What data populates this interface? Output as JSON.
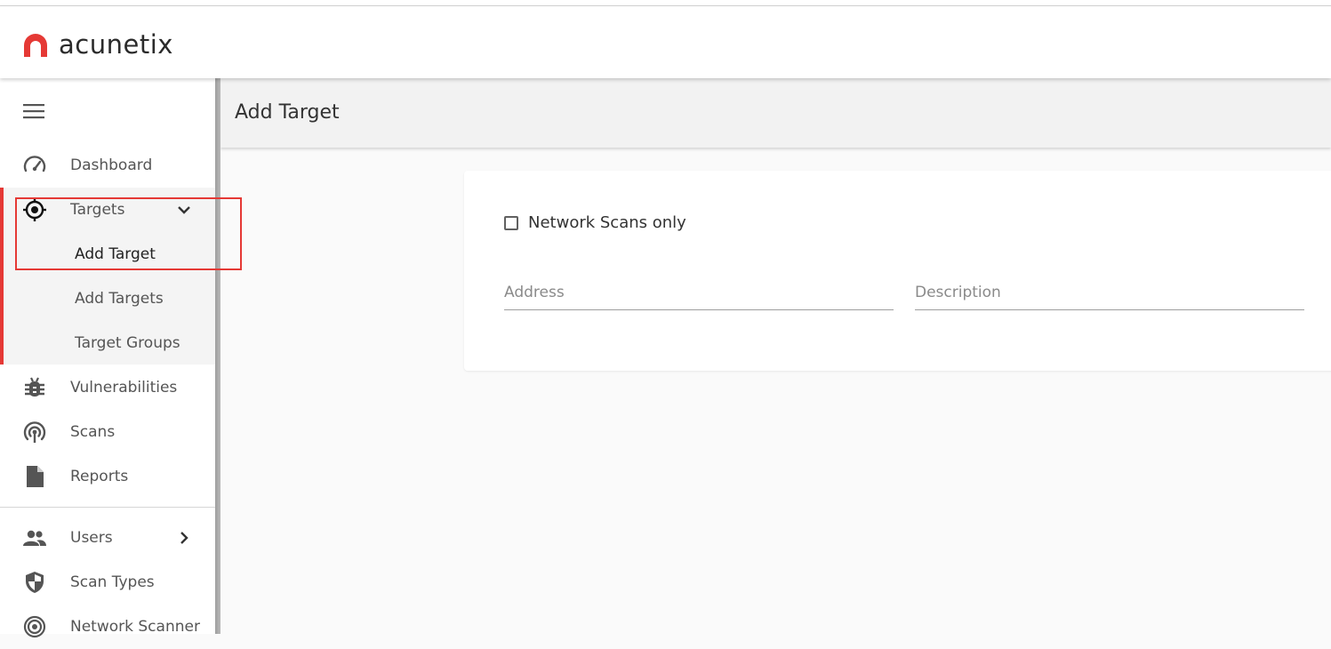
{
  "app": {
    "brand_name": "acunetix",
    "accent_color": "#e53935"
  },
  "sidebar": {
    "menu_icon": "hamburger-icon",
    "items": [
      {
        "label": "Dashboard",
        "icon": "speedometer-icon"
      },
      {
        "label": "Targets",
        "icon": "target-crosshair-icon",
        "expanded": true
      },
      {
        "label": "Vulnerabilities",
        "icon": "bug-icon"
      },
      {
        "label": "Scans",
        "icon": "radar-icon"
      },
      {
        "label": "Reports",
        "icon": "document-icon"
      },
      {
        "label": "Users",
        "icon": "users-icon"
      },
      {
        "label": "Scan Types",
        "icon": "shield-icon"
      },
      {
        "label": "Network Scanner",
        "icon": "network-scanner-icon"
      }
    ],
    "targets_submenu": [
      {
        "label": "Add Target",
        "active": true
      },
      {
        "label": "Add Targets"
      },
      {
        "label": "Target Groups"
      }
    ]
  },
  "page": {
    "title": "Add Target"
  },
  "form": {
    "network_scans_only_label": "Network Scans only",
    "network_scans_only_checked": false,
    "address_placeholder": "Address",
    "description_placeholder": "Description"
  }
}
